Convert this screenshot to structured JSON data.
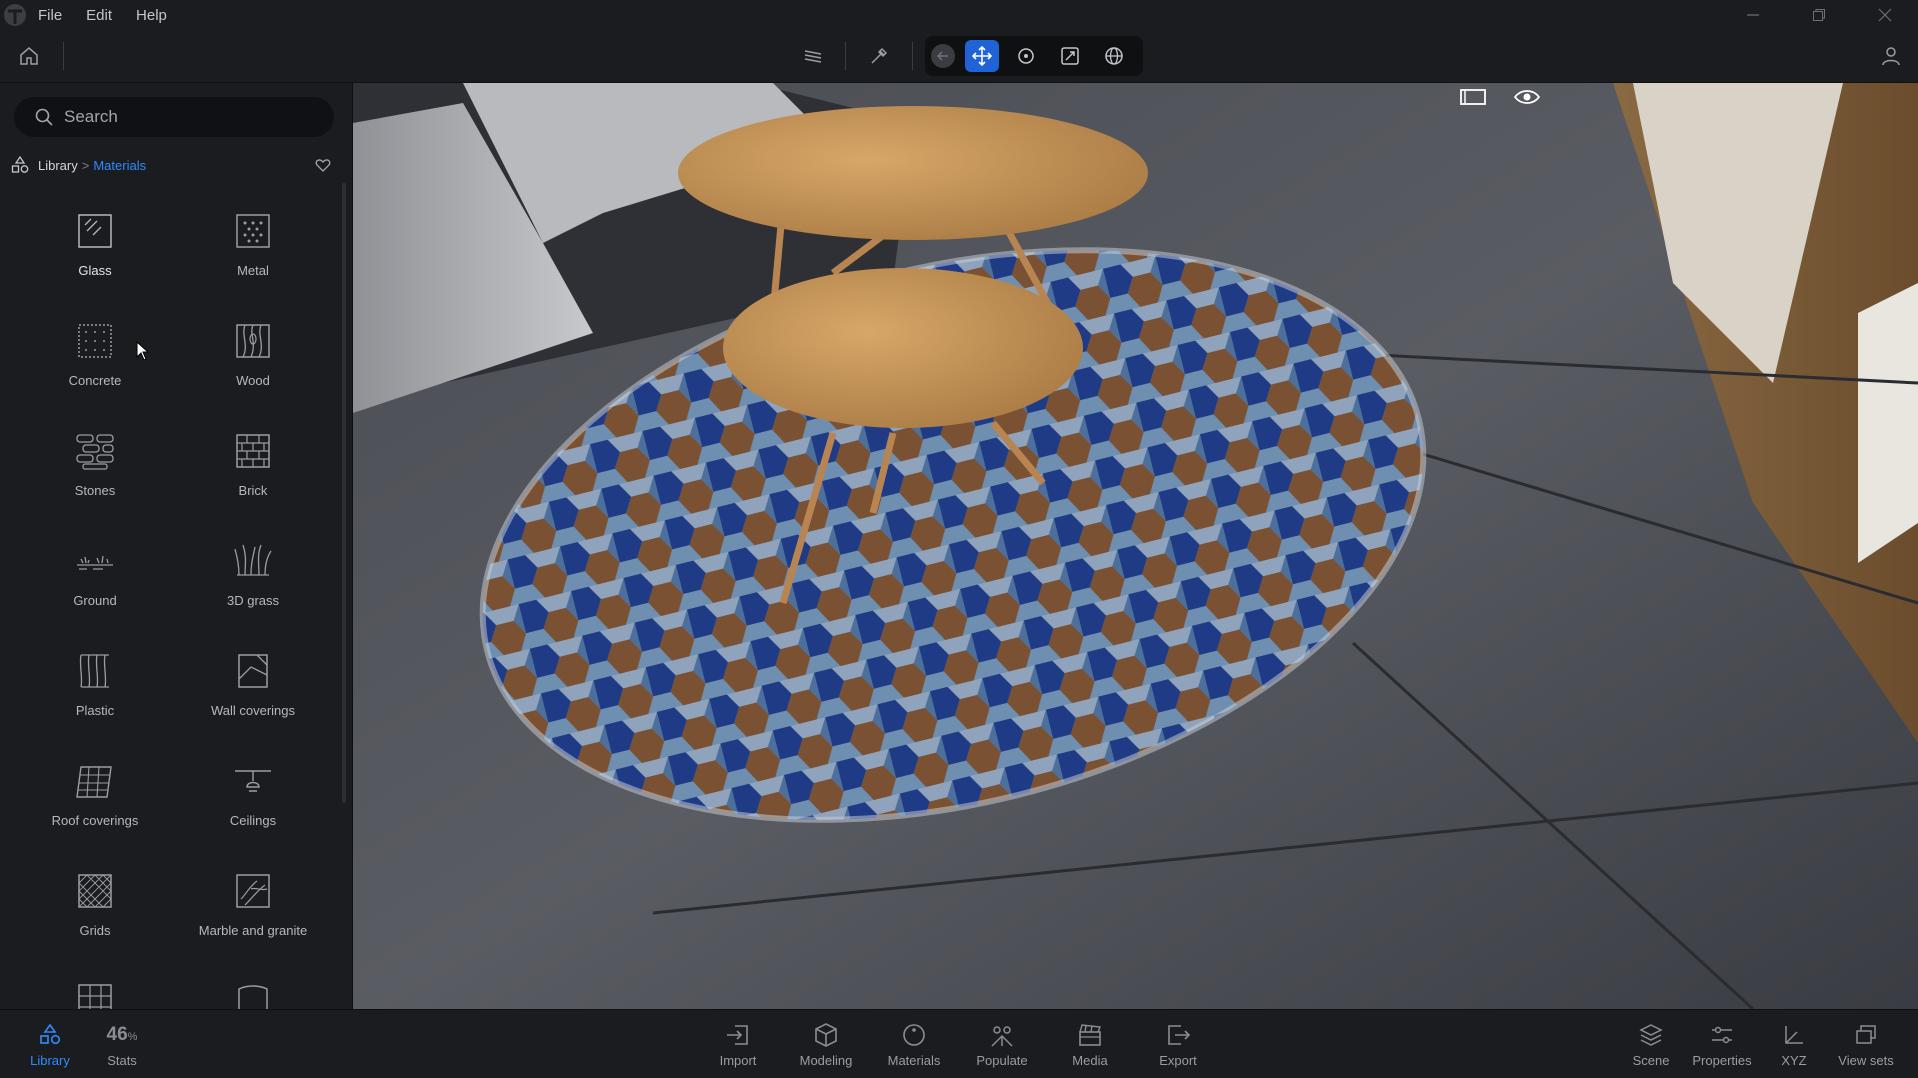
{
  "menubar": {
    "items": [
      "File",
      "Edit",
      "Help"
    ]
  },
  "sidebar": {
    "search_placeholder": "Search",
    "breadcrumb": {
      "root": "Library",
      "separator": ">",
      "current": "Materials"
    },
    "categories": [
      "Glass",
      "Metal",
      "Concrete",
      "Wood",
      "Stones",
      "Brick",
      "Ground",
      "3D grass",
      "Plastic",
      "Wall coverings",
      "Roof coverings",
      "Ceilings",
      "Grids",
      "Marble and granite"
    ]
  },
  "bottombar": {
    "library_label": "Library",
    "stats_value": "46",
    "stats_unit": "%",
    "stats_label": "Stats",
    "center_items": [
      "Import",
      "Modeling",
      "Materials",
      "Populate",
      "Media",
      "Export"
    ],
    "right_items": [
      "Scene",
      "Properties",
      "XYZ",
      "View sets"
    ]
  },
  "colors": {
    "accent": "#2f8cff",
    "active_tool": "#1f63d6",
    "background": "#1b1c1f"
  }
}
